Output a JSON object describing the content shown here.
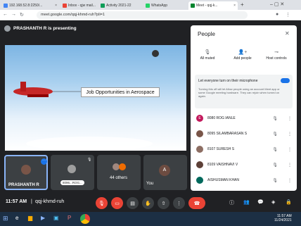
{
  "tabs": [
    "192.168.52.8:2250/...",
    "Inbox - qjw mail...",
    "Activity 2021-22",
    "WhatsApp",
    "Meet - qqj-k..."
  ],
  "url": "meet.google.com/qqj-khmd-ruh?pli=1",
  "presenting": "PRASHANTH R is presenting",
  "slide": {
    "banner": "Job Opportunities in  Aerospace"
  },
  "tiles": [
    {
      "name": "PRASHANTH R"
    },
    {
      "name": "8096...ROG..."
    },
    {
      "name": "44 others"
    },
    {
      "name": "You",
      "initial": "A"
    }
  ],
  "bottom": {
    "time": "11:57 AM",
    "code": "qqj-khmd-ruh"
  },
  "people": {
    "title": "People",
    "actions": [
      "All muted",
      "Add people",
      "Host controls"
    ],
    "toggle_text": "Let everyone turn on their microphone",
    "toggle_desc": "Turning this off will let Allow people using an account Meet app or some Google meeting hardware. They can rejoin when turned on again.",
    "list": [
      {
        "initial": "E",
        "name": "8080 ROG IANLE",
        "color": "#c2185b"
      },
      {
        "initial": "",
        "name": "8095 SILAMBARASAN S",
        "color": "#795548"
      },
      {
        "initial": "",
        "name": "8107 SURESH S",
        "color": "#8d6e63"
      },
      {
        "initial": "",
        "name": "8109 VAISHNAVI V",
        "color": "#5d4037"
      },
      {
        "initial": "",
        "name": "AISHUSMAN KHAN",
        "color": "#00695c"
      }
    ]
  },
  "taskbar": {
    "time": "11:57 AM",
    "date": "11/24/2021"
  }
}
